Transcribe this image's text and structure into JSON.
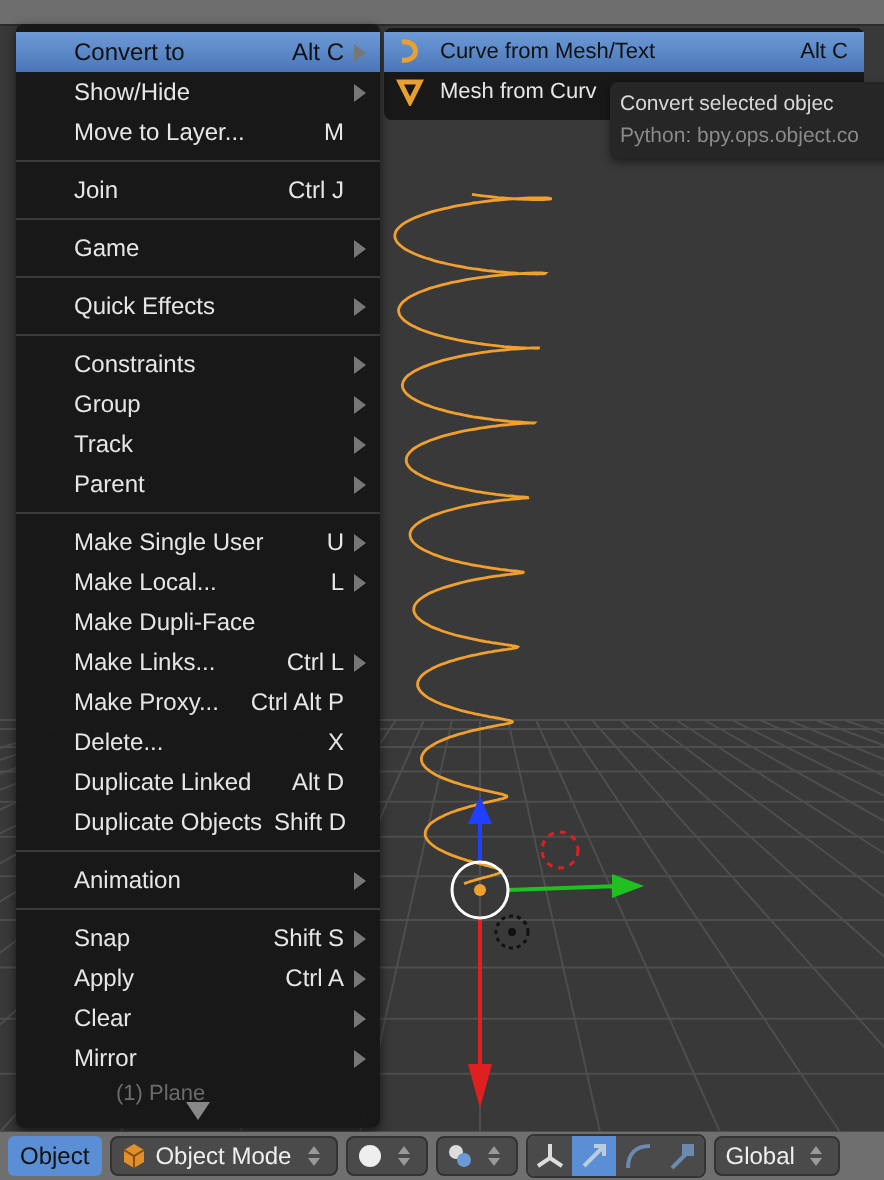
{
  "viewport": {
    "object_label": "(1) Plane"
  },
  "menu": {
    "items": [
      {
        "kind": "item",
        "label": "Convert to",
        "shortcut": "Alt C",
        "submenu": true,
        "selected": true
      },
      {
        "kind": "item",
        "label": "Show/Hide",
        "submenu": true,
        "selected": false
      },
      {
        "kind": "item",
        "label": "Move to Layer...",
        "shortcut": "M",
        "submenu": false,
        "selected": false
      },
      {
        "kind": "separator"
      },
      {
        "kind": "item",
        "label": "Join",
        "shortcut": "Ctrl J",
        "submenu": false,
        "selected": false
      },
      {
        "kind": "separator"
      },
      {
        "kind": "item",
        "label": "Game",
        "submenu": true,
        "selected": false
      },
      {
        "kind": "separator"
      },
      {
        "kind": "item",
        "label": "Quick Effects",
        "submenu": true,
        "selected": false
      },
      {
        "kind": "separator"
      },
      {
        "kind": "item",
        "label": "Constraints",
        "submenu": true,
        "selected": false
      },
      {
        "kind": "item",
        "label": "Group",
        "submenu": true,
        "selected": false
      },
      {
        "kind": "item",
        "label": "Track",
        "submenu": true,
        "selected": false
      },
      {
        "kind": "item",
        "label": "Parent",
        "submenu": true,
        "selected": false
      },
      {
        "kind": "separator"
      },
      {
        "kind": "item",
        "label": "Make Single User",
        "shortcut": "U",
        "submenu": true,
        "selected": false
      },
      {
        "kind": "item",
        "label": "Make Local...",
        "shortcut": "L",
        "submenu": true,
        "selected": false
      },
      {
        "kind": "item",
        "label": "Make Dupli-Face",
        "submenu": false,
        "selected": false
      },
      {
        "kind": "item",
        "label": "Make Links...",
        "shortcut": "Ctrl L",
        "submenu": true,
        "selected": false
      },
      {
        "kind": "item",
        "label": "Make Proxy...",
        "shortcut": "Ctrl Alt P",
        "submenu": false,
        "selected": false
      },
      {
        "kind": "item",
        "label": "Delete...",
        "shortcut": "X",
        "submenu": false,
        "selected": false
      },
      {
        "kind": "item",
        "label": "Duplicate Linked",
        "shortcut": "Alt D",
        "submenu": false,
        "selected": false
      },
      {
        "kind": "item",
        "label": "Duplicate Objects",
        "shortcut": "Shift D",
        "submenu": false,
        "selected": false
      },
      {
        "kind": "separator"
      },
      {
        "kind": "item",
        "label": "Animation",
        "submenu": true,
        "selected": false
      },
      {
        "kind": "separator"
      },
      {
        "kind": "item",
        "label": "Snap",
        "shortcut": "Shift S",
        "submenu": true,
        "selected": false
      },
      {
        "kind": "item",
        "label": "Apply",
        "shortcut": "Ctrl A",
        "submenu": true,
        "selected": false
      },
      {
        "kind": "item",
        "label": "Clear",
        "submenu": true,
        "selected": false
      },
      {
        "kind": "item",
        "label": "Mirror",
        "submenu": true,
        "selected": false
      }
    ]
  },
  "submenu": {
    "items": [
      {
        "kind": "curve",
        "label": "Curve from Mesh/Text",
        "shortcut": "Alt C",
        "selected": true
      },
      {
        "kind": "mesh",
        "label": "Mesh from Curv",
        "selected": false
      }
    ]
  },
  "tooltip": {
    "lines": [
      "Convert selected objec",
      "Python: bpy.ops.object.co"
    ]
  },
  "bottom_bar": {
    "menu_button": {
      "label": "Object",
      "selected": true
    },
    "mode": "Object Mode",
    "orientation": "Global"
  }
}
